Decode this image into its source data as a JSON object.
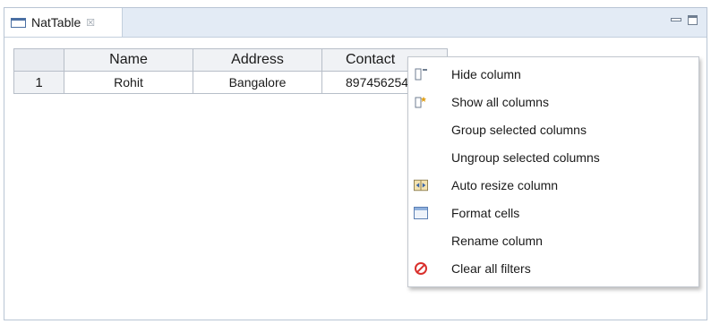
{
  "tab": {
    "title": "NatTable",
    "close_glyph": "☒"
  },
  "table": {
    "columns": [
      "Name",
      "Address",
      "Contact"
    ],
    "rows": [
      {
        "num": "1",
        "name": "Rohit",
        "address": "Bangalore",
        "contact": "897456254"
      }
    ]
  },
  "menu": {
    "items": [
      {
        "label": "Hide column",
        "icon": "hide-column-icon"
      },
      {
        "label": "Show all columns",
        "icon": "show-all-columns-icon"
      },
      {
        "label": "Group selected columns",
        "icon": ""
      },
      {
        "label": "Ungroup selected columns",
        "icon": ""
      },
      {
        "label": "Auto resize column",
        "icon": "auto-resize-icon"
      },
      {
        "label": "Format cells",
        "icon": "format-cells-icon"
      },
      {
        "label": "Rename column",
        "icon": ""
      },
      {
        "label": "Clear all filters",
        "icon": "clear-filters-icon"
      }
    ]
  },
  "colors": {
    "accent": "#4a6fa3",
    "tabbar": "#e3ebf5",
    "clear_filter_red": "#d9302c"
  }
}
